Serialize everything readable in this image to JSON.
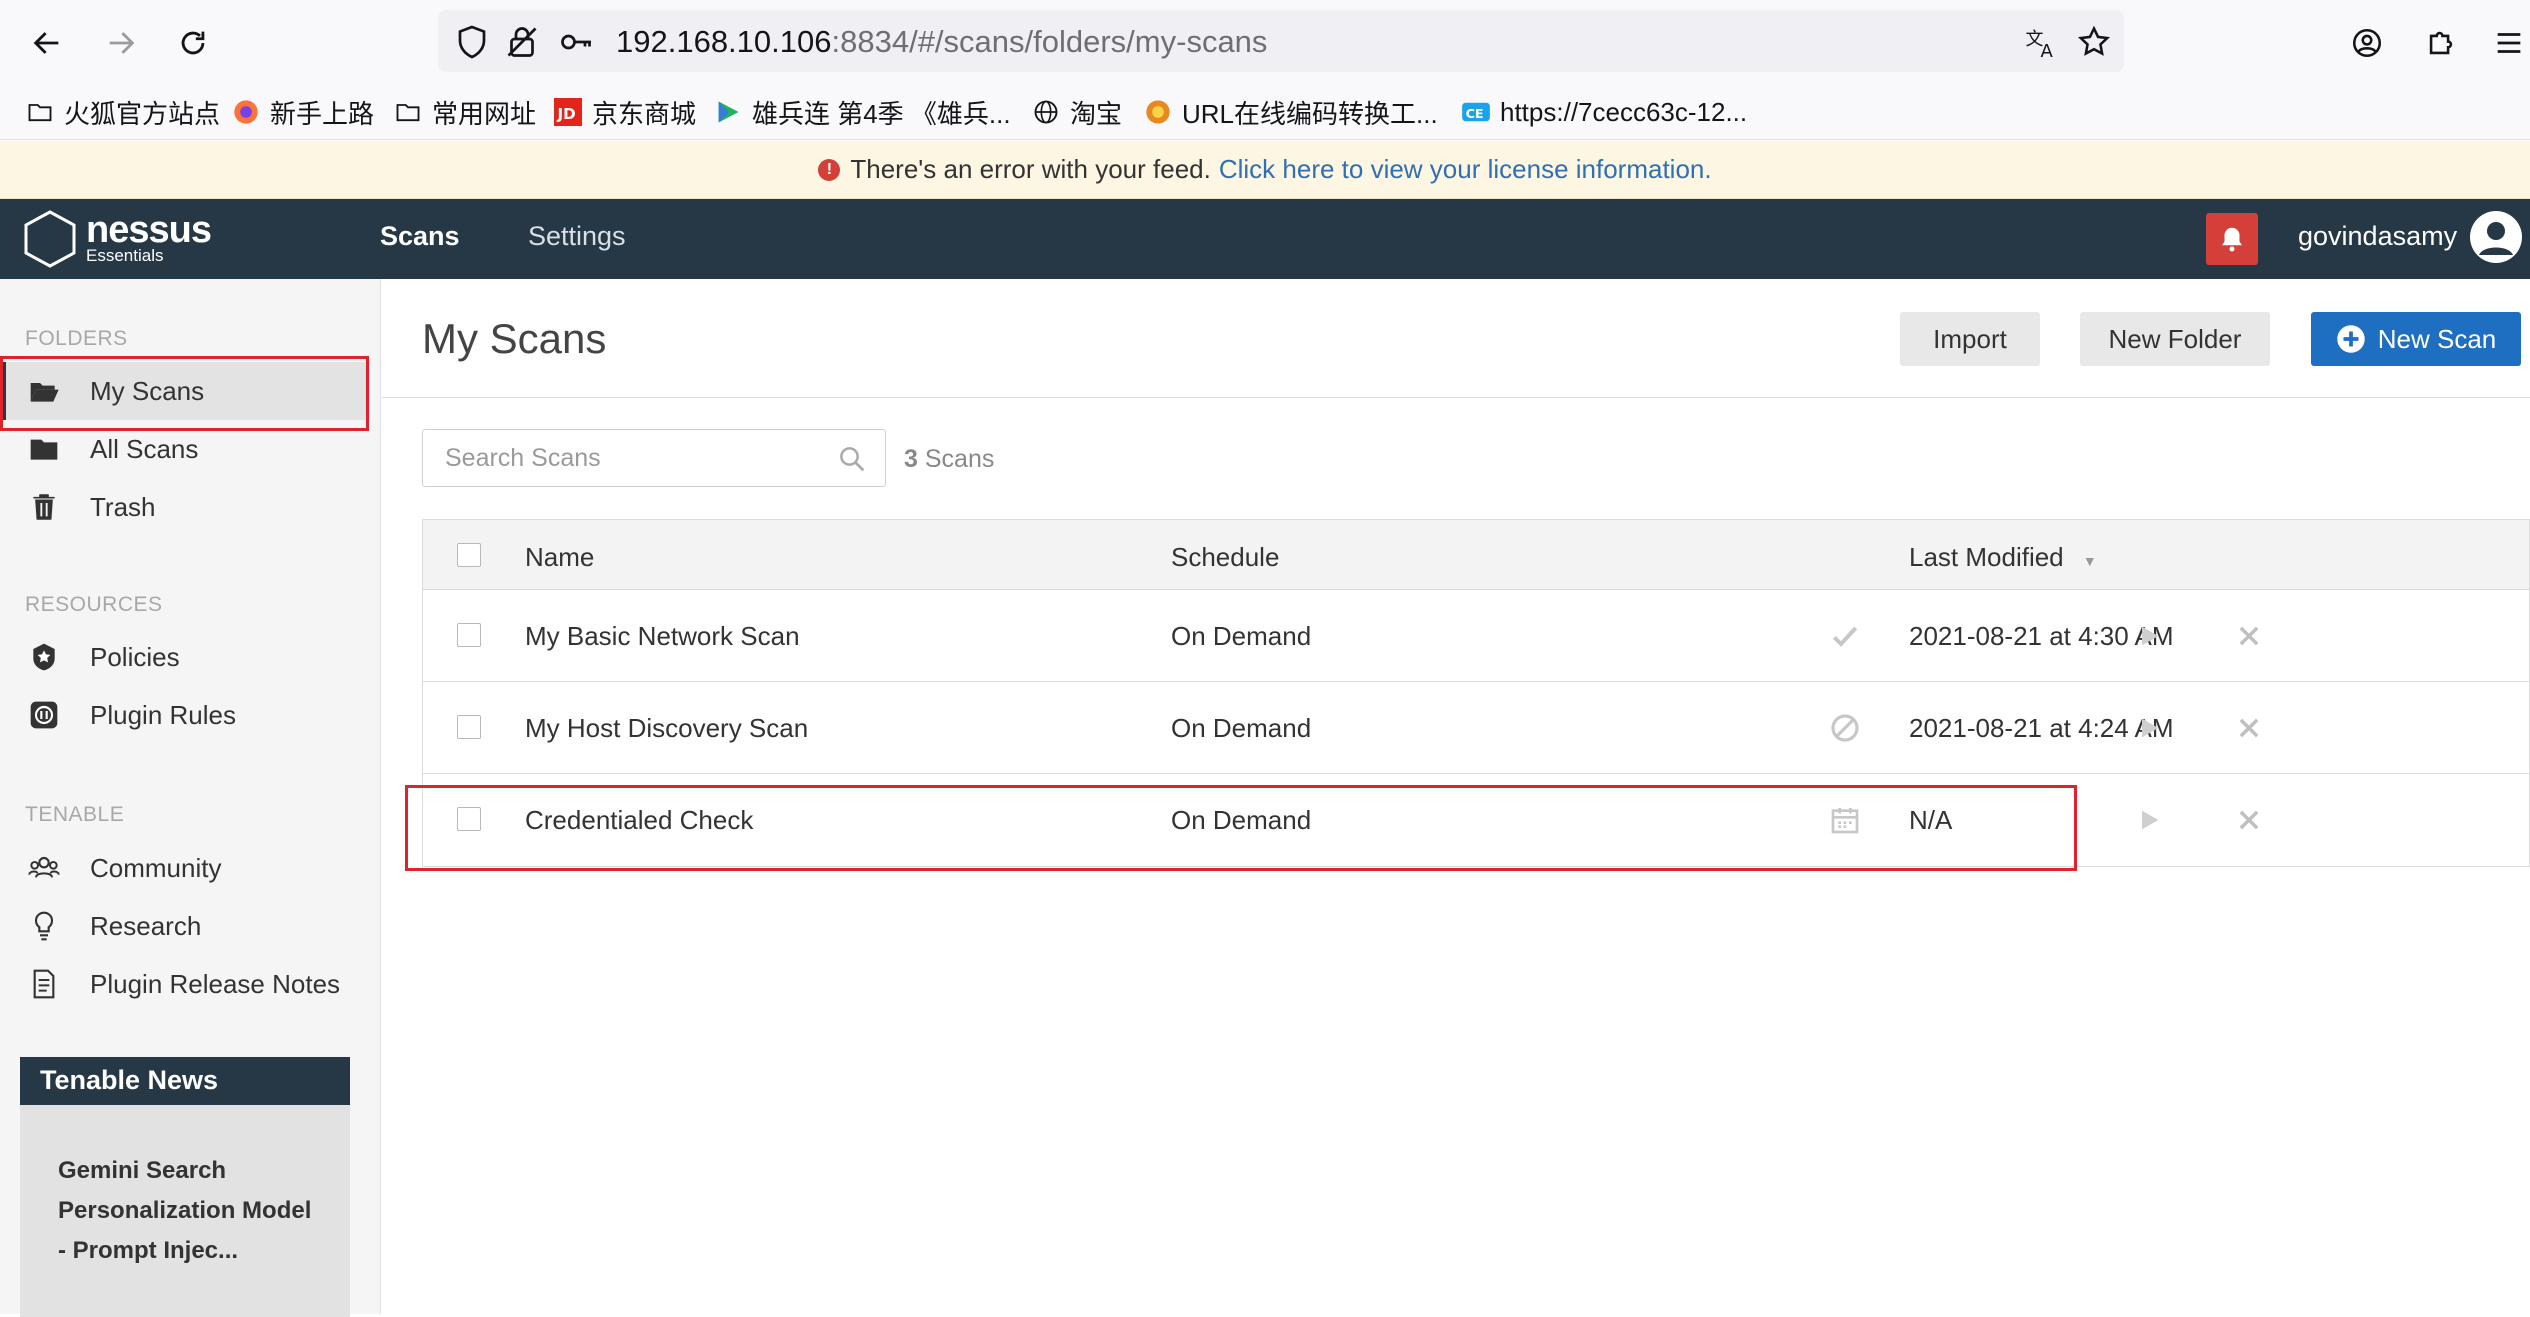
{
  "browser": {
    "url_host": "192.168.10.106",
    "url_path": ":8834/#/scans/folders/my-scans"
  },
  "bookmarks": [
    {
      "label": "火狐官方站点",
      "icon": "folder-icon"
    },
    {
      "label": "新手上路",
      "icon": "firefox-icon"
    },
    {
      "label": "常用网址",
      "icon": "folder-icon"
    },
    {
      "label": "京东商城",
      "icon": "jd-icon"
    },
    {
      "label": "雄兵连 第4季 《雄兵...",
      "icon": "play-icon"
    },
    {
      "label": "淘宝",
      "icon": "globe-icon"
    },
    {
      "label": "URL在线编码转换工...",
      "icon": "tool-icon"
    },
    {
      "label": "https://7cecc63c-12...",
      "icon": "ce-icon"
    }
  ],
  "banner": {
    "message": "There's an error with your feed.",
    "link": "Click here to view your license information."
  },
  "header": {
    "logo": "nessus",
    "logo_sub": "Essentials",
    "tabs": [
      "Scans",
      "Settings"
    ],
    "username": "govindasamy"
  },
  "sidebar": {
    "folders_label": "FOLDERS",
    "folders": [
      "My Scans",
      "All Scans",
      "Trash"
    ],
    "resources_label": "RESOURCES",
    "resources": [
      "Policies",
      "Plugin Rules"
    ],
    "tenable_label": "TENABLE",
    "tenable": [
      "Community",
      "Research",
      "Plugin Release Notes"
    ],
    "news_title": "Tenable News",
    "news_item": "Gemini Search Personalization Model - Prompt Injec..."
  },
  "main": {
    "title": "My Scans",
    "import_label": "Import",
    "new_folder_label": "New Folder",
    "new_scan_label": "New Scan",
    "search_placeholder": "Search Scans",
    "count_num": "3",
    "count_label": "Scans",
    "columns": {
      "name": "Name",
      "schedule": "Schedule",
      "modified": "Last Modified"
    },
    "rows": [
      {
        "name": "My Basic Network Scan",
        "schedule": "On Demand",
        "status": "completed-check-icon",
        "modified": "2021-08-21 at 4:30 AM"
      },
      {
        "name": "My Host Discovery Scan",
        "schedule": "On Demand",
        "status": "canceled-icon",
        "modified": "2021-08-21 at 4:24 AM"
      },
      {
        "name": "Credentialed Check",
        "schedule": "On Demand",
        "status": "calendar-icon",
        "modified": "N/A"
      }
    ]
  },
  "colors": {
    "header_bg": "#263746",
    "accent_blue": "#1e6fc1",
    "alert_red": "#d43f3a",
    "highlight_box": "#e0222a"
  }
}
